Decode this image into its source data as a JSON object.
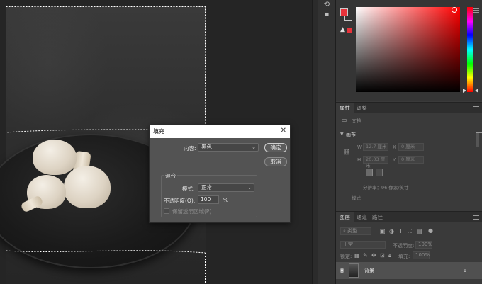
{
  "color_panel": {
    "foreground_color": "#e7333b",
    "hue_color": "#ff0000"
  },
  "properties_panel": {
    "tabs": [
      "属性",
      "调整"
    ],
    "doc_label": "文档",
    "canvas_section": "画布",
    "w_label": "W",
    "w_value": "12.7 厘米",
    "x_label": "X",
    "x_value": "0 厘米",
    "h_label": "H",
    "h_value": "20.03 厘米",
    "y_label": "Y",
    "y_value": "0 厘米",
    "resolution": "分辨率：96 像素/英寸",
    "mode_label": "模式"
  },
  "layers_panel": {
    "tabs": [
      "图层",
      "通道",
      "路径"
    ],
    "filter_kind": "类型",
    "blend_mode": "正常",
    "opacity_label": "不透明度:",
    "opacity_value": "100%",
    "lock_label": "锁定:",
    "fill_label": "填充:",
    "fill_value": "100%",
    "layer_name": "背景"
  },
  "fill_dialog": {
    "title": "填充",
    "content_label": "内容:",
    "content_value": "黑色",
    "ok_label": "确定",
    "cancel_label": "取消",
    "blending_group": "混合",
    "mode_label": "模式:",
    "mode_value": "正常",
    "opacity_label": "不透明度(O):",
    "opacity_value": "100",
    "opacity_unit": "%",
    "preserve_label": "保留透明区域(P)"
  }
}
